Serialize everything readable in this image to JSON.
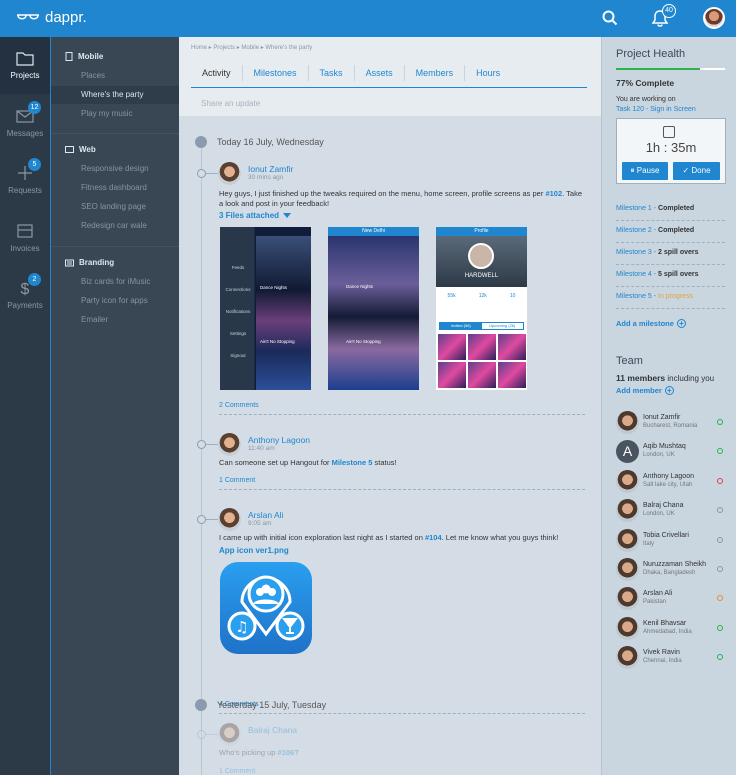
{
  "app": {
    "logo": "dappr."
  },
  "topbar": {
    "notif_count": "40"
  },
  "leftnav": [
    {
      "label": "Projects",
      "icon": "folder-icon",
      "badge": ""
    },
    {
      "label": "Messages",
      "icon": "mail-icon",
      "badge": "12"
    },
    {
      "label": "Requests",
      "icon": "plus-icon",
      "badge": "5"
    },
    {
      "label": "Invoices",
      "icon": "invoice-icon",
      "badge": ""
    },
    {
      "label": "Payments",
      "icon": "dollar-icon",
      "badge": "2"
    }
  ],
  "subnav": {
    "mobile": {
      "title": "Mobile",
      "items": [
        "Places",
        "Where's the party",
        "Play my music"
      ]
    },
    "web": {
      "title": "Web",
      "items": [
        "Responsive design",
        "Fitness dashboard",
        "SEO landing page",
        "Redesign car wale"
      ]
    },
    "branding": {
      "title": "Branding",
      "items": [
        "Biz cards for iMusic",
        "Party icon for apps",
        "Emailer"
      ]
    }
  },
  "main": {
    "breadcrumb": "Home ▸ Projects ▸ Mobile ▸ Where's the party",
    "tabs": [
      "Activity",
      "Milestones",
      "Tasks",
      "Assets",
      "Members",
      "Hours"
    ],
    "share_placeholder": "Share an update",
    "day1": "Today 16 July, Wednesday",
    "day2": "Yesterday 15 July, Tuesday",
    "posts": [
      {
        "name": "Ionut Zamfir",
        "time": "30 mins ago",
        "text1": "Hey guys, I just finished up the tweaks required on the menu, home screen, profile screens as per ",
        "ref": "#102",
        "text2": ". Take a look and post in your feedback!",
        "attach": "3 Files attached",
        "comments": "2 Comments"
      },
      {
        "name": "Anthony Lagoon",
        "time": "11:40 am",
        "text1": "Can someone set up Hangout for ",
        "ref": "Milestone 5",
        "text2": " status!",
        "comments": "1 Comment"
      },
      {
        "name": "Arslan Ali",
        "time": "9:05 am",
        "text1": "I came up with initial icon exploration last night as I started on ",
        "ref": "#104",
        "text2": ". Let me know what you guys think!",
        "attach": "App icon ver1.png",
        "comments": "4 Comments"
      },
      {
        "name": "Balraj Chana",
        "time": "",
        "text1": "Who's picking up ",
        "ref": "#106",
        "text2": "?",
        "comments": "1 Comment"
      }
    ],
    "shots": {
      "s1_items": [
        "Feeds",
        "Connections",
        "Notifications",
        "Settings",
        "Signout"
      ],
      "s1_events": [
        "Dance Nights",
        "Ain't No Stopping"
      ],
      "s2_title": "New Delhi",
      "s2_events": [
        "Dance Nights",
        "Ain't No Stopping"
      ],
      "s3_title": "Profile",
      "s3_name": "HARDWELL",
      "s3_stats": [
        "55k",
        "12k",
        "10"
      ],
      "s3_tabs": [
        "Invited (56)",
        "Upcoming (26)"
      ]
    }
  },
  "right": {
    "title": "Project Health",
    "progress": 0.77,
    "complete": "77% Complete",
    "working_on": "You are working on",
    "task": "Task 120 - Sign in Screen",
    "timer": "1h : 35m",
    "pause": "Pause",
    "done": "Done",
    "milestones": [
      {
        "name": "Milestone 1",
        "status": "Completed"
      },
      {
        "name": "Milestone 2",
        "status": "Completed"
      },
      {
        "name": "Milestone 3",
        "status": "2 spill overs"
      },
      {
        "name": "Milestone 4",
        "status": "5 spill overs"
      },
      {
        "name": "Milestone 5",
        "status": "In progress"
      }
    ],
    "add_milestone": "Add a milestone",
    "team_title": "Team",
    "members_count": "11 members",
    "members_suffix": "including you",
    "add_member": "Add member",
    "team": [
      {
        "name": "Ionut Zamfir",
        "loc": "Bucharest, Romania",
        "status": "green"
      },
      {
        "name": "Aqib Mushtaq",
        "loc": "London, UK",
        "status": "green",
        "initial": "A"
      },
      {
        "name": "Anthony Lagoon",
        "loc": "Salt lake city, Utah",
        "status": "red"
      },
      {
        "name": "Balraj Chana",
        "loc": "London, UK",
        "status": "gray"
      },
      {
        "name": "Tobia Crivellari",
        "loc": "Italy",
        "status": "gray"
      },
      {
        "name": "Nuruzzaman Sheikh",
        "loc": "Dhaka, Bangladesh",
        "status": "gray"
      },
      {
        "name": "Arslan Ali",
        "loc": "Pakistan",
        "status": "orange"
      },
      {
        "name": "Kenil Bhavsar",
        "loc": "Ahmedabad, India",
        "status": "green"
      },
      {
        "name": "Vivek Ravin",
        "loc": "Chennai, India",
        "status": "green"
      }
    ]
  }
}
